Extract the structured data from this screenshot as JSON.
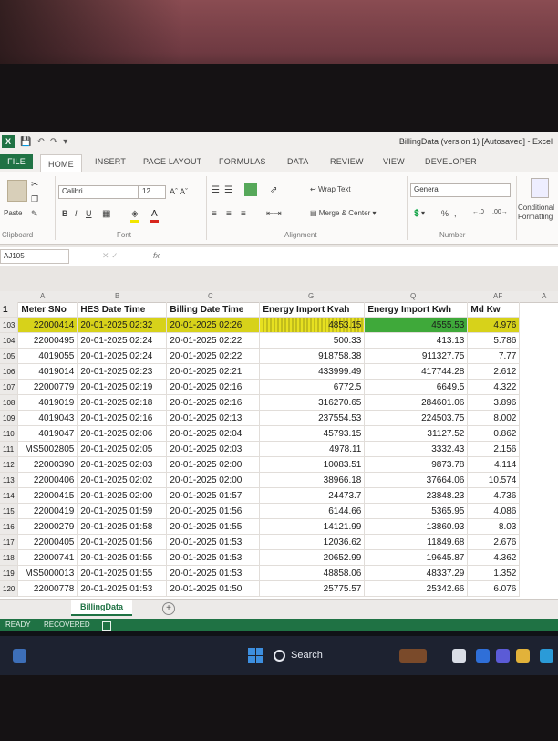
{
  "window": {
    "title": "BillingData (version 1) [Autosaved] - Excel"
  },
  "ribbon_tabs": [
    "FILE",
    "HOME",
    "INSERT",
    "PAGE LAYOUT",
    "FORMULAS",
    "DATA",
    "REVIEW",
    "VIEW",
    "DEVELOPER"
  ],
  "ribbon": {
    "paste_label": "Paste",
    "font_name": "Calibri",
    "font_size": "12",
    "wrap_text": "Wrap Text",
    "merge_center": "Merge & Center",
    "number_format": "General",
    "conditional_formatting": "Conditional Formatting",
    "groups": {
      "clipboard": "Clipboard",
      "font": "Font",
      "alignment": "Alignment",
      "number": "Number"
    }
  },
  "formula_bar": {
    "name_box": "AJ105",
    "fx_label": "fx"
  },
  "column_letters": [
    "A",
    "B",
    "C",
    "G",
    "Q",
    "AF",
    "A"
  ],
  "sheet": {
    "headers": {
      "meter": "Meter SNo",
      "hes": "HES Date Time",
      "billing": "Billing Date Time",
      "kvah": "Energy Import Kvah",
      "kwh": "Energy Import Kwh",
      "md": "Md Kw"
    },
    "header_row_number": "1",
    "rows": [
      {
        "row": "103",
        "meter": "22000414",
        "hes": "20-01-2025 02:32",
        "billing": "20-01-2025 02:26",
        "kvah": "4853.15",
        "kwh": "4555.53",
        "md": "4.976"
      },
      {
        "row": "104",
        "meter": "22000495",
        "hes": "20-01-2025 02:24",
        "billing": "20-01-2025 02:22",
        "kvah": "500.33",
        "kwh": "413.13",
        "md": "5.786"
      },
      {
        "row": "105",
        "meter": "4019055",
        "hes": "20-01-2025 02:24",
        "billing": "20-01-2025 02:22",
        "kvah": "918758.38",
        "kwh": "911327.75",
        "md": "7.77"
      },
      {
        "row": "106",
        "meter": "4019014",
        "hes": "20-01-2025 02:23",
        "billing": "20-01-2025 02:21",
        "kvah": "433999.49",
        "kwh": "417744.28",
        "md": "2.612"
      },
      {
        "row": "107",
        "meter": "22000779",
        "hes": "20-01-2025 02:19",
        "billing": "20-01-2025 02:16",
        "kvah": "6772.5",
        "kwh": "6649.5",
        "md": "4.322"
      },
      {
        "row": "108",
        "meter": "4019019",
        "hes": "20-01-2025 02:18",
        "billing": "20-01-2025 02:16",
        "kvah": "316270.65",
        "kwh": "284601.06",
        "md": "3.896"
      },
      {
        "row": "109",
        "meter": "4019043",
        "hes": "20-01-2025 02:16",
        "billing": "20-01-2025 02:13",
        "kvah": "237554.53",
        "kwh": "224503.75",
        "md": "8.002"
      },
      {
        "row": "110",
        "meter": "4019047",
        "hes": "20-01-2025 02:06",
        "billing": "20-01-2025 02:04",
        "kvah": "45793.15",
        "kwh": "31127.52",
        "md": "0.862"
      },
      {
        "row": "111",
        "meter": "MS5002805",
        "hes": "20-01-2025 02:05",
        "billing": "20-01-2025 02:03",
        "kvah": "4978.11",
        "kwh": "3332.43",
        "md": "2.156"
      },
      {
        "row": "112",
        "meter": "22000390",
        "hes": "20-01-2025 02:03",
        "billing": "20-01-2025 02:00",
        "kvah": "10083.51",
        "kwh": "9873.78",
        "md": "4.114"
      },
      {
        "row": "113",
        "meter": "22000406",
        "hes": "20-01-2025 02:02",
        "billing": "20-01-2025 02:00",
        "kvah": "38966.18",
        "kwh": "37664.06",
        "md": "10.574"
      },
      {
        "row": "114",
        "meter": "22000415",
        "hes": "20-01-2025 02:00",
        "billing": "20-01-2025 01:57",
        "kvah": "24473.7",
        "kwh": "23848.23",
        "md": "4.736"
      },
      {
        "row": "115",
        "meter": "22000419",
        "hes": "20-01-2025 01:59",
        "billing": "20-01-2025 01:56",
        "kvah": "6144.66",
        "kwh": "5365.95",
        "md": "4.086"
      },
      {
        "row": "116",
        "meter": "22000279",
        "hes": "20-01-2025 01:58",
        "billing": "20-01-2025 01:55",
        "kvah": "14121.99",
        "kwh": "13860.93",
        "md": "8.03"
      },
      {
        "row": "117",
        "meter": "22000405",
        "hes": "20-01-2025 01:56",
        "billing": "20-01-2025 01:53",
        "kvah": "12036.62",
        "kwh": "11849.68",
        "md": "2.676"
      },
      {
        "row": "118",
        "meter": "22000741",
        "hes": "20-01-2025 01:55",
        "billing": "20-01-2025 01:53",
        "kvah": "20652.99",
        "kwh": "19645.87",
        "md": "4.362"
      },
      {
        "row": "119",
        "meter": "MS5000013",
        "hes": "20-01-2025 01:55",
        "billing": "20-01-2025 01:53",
        "kvah": "48858.06",
        "kwh": "48337.29",
        "md": "1.352"
      },
      {
        "row": "120",
        "meter": "22000778",
        "hes": "20-01-2025 01:53",
        "billing": "20-01-2025 01:50",
        "kvah": "25775.57",
        "kwh": "25342.66",
        "md": "6.076"
      }
    ]
  },
  "sheet_tab": "BillingData",
  "status_bar": {
    "ready": "READY",
    "recovered": "RECOVERED"
  },
  "taskbar": {
    "search_label": "Search"
  },
  "colors": {
    "excel_green": "#1f7244",
    "highlight_yellow": "#d7d21a",
    "highlight_green": "#3fa93a"
  }
}
